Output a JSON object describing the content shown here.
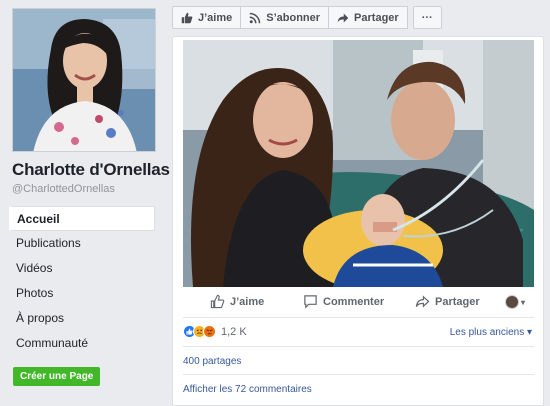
{
  "profile": {
    "name": "Charlotte d'Ornellas",
    "handle": "@CharlottedOrnellas"
  },
  "nav": {
    "items": [
      {
        "label": "Accueil",
        "active": true
      },
      {
        "label": "Publications"
      },
      {
        "label": "Vidéos"
      },
      {
        "label": "Photos"
      },
      {
        "label": "À propos"
      },
      {
        "label": "Communauté"
      }
    ],
    "create_page": "Créer une Page"
  },
  "actionbar": {
    "like": "J’aime",
    "subscribe": "S’abonner",
    "share": "Partager",
    "more": "···"
  },
  "post": {
    "actions": {
      "like": "J’aime",
      "comment": "Commenter",
      "share": "Partager"
    },
    "reactions": {
      "count": "1,2 K",
      "types": [
        "like-icon",
        "sad-icon",
        "angry-icon"
      ]
    },
    "sort": "Les plus anciens ▾",
    "shares": "400 partages",
    "comments": "Afficher les 72 commentaires"
  },
  "colors": {
    "link": "#385898",
    "create_button": "#42b72a",
    "background": "#e9ebee"
  }
}
